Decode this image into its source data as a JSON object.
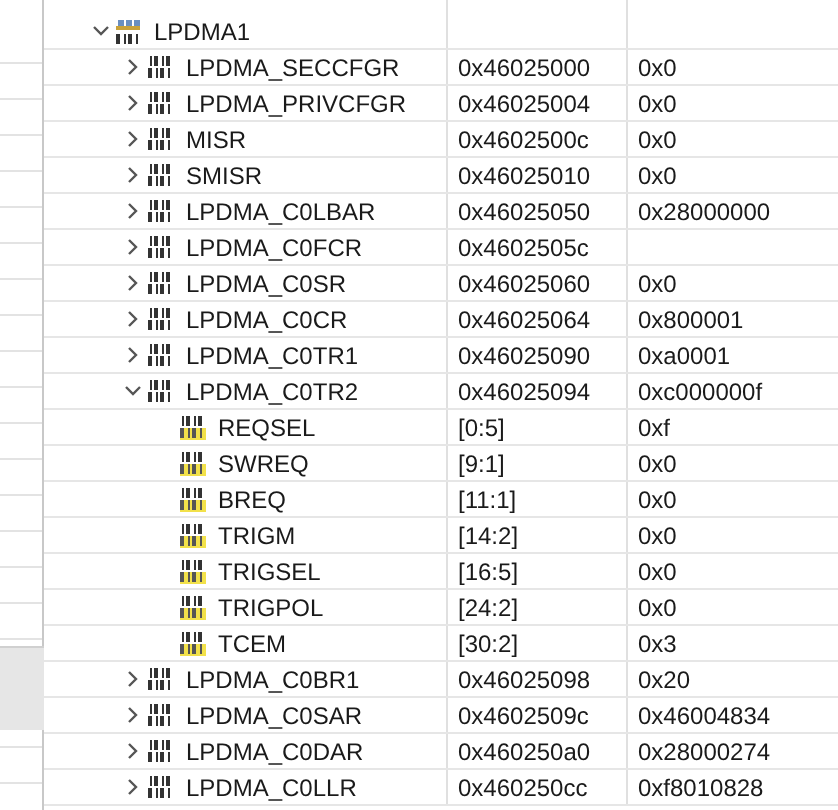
{
  "tree": {
    "kind": "peripheral",
    "name": "LPDMA1",
    "expanded": true,
    "children": [
      {
        "kind": "register",
        "name": "LPDMA_SECCFGR",
        "address": "0x46025000",
        "value": "0x0",
        "expanded": false
      },
      {
        "kind": "register",
        "name": "LPDMA_PRIVCFGR",
        "address": "0x46025004",
        "value": "0x0",
        "expanded": false
      },
      {
        "kind": "register",
        "name": "MISR",
        "address": "0x4602500c",
        "value": "0x0",
        "expanded": false
      },
      {
        "kind": "register",
        "name": "SMISR",
        "address": "0x46025010",
        "value": "0x0",
        "expanded": false
      },
      {
        "kind": "register",
        "name": "LPDMA_C0LBAR",
        "address": "0x46025050",
        "value": "0x28000000",
        "expanded": false
      },
      {
        "kind": "register",
        "name": "LPDMA_C0FCR",
        "address": "0x4602505c",
        "expanded": false
      },
      {
        "kind": "register",
        "name": "LPDMA_C0SR",
        "address": "0x46025060",
        "value": "0x0",
        "expanded": false
      },
      {
        "kind": "register",
        "name": "LPDMA_C0CR",
        "address": "0x46025064",
        "value": "0x800001",
        "expanded": false
      },
      {
        "kind": "register",
        "name": "LPDMA_C0TR1",
        "address": "0x46025090",
        "value": "0xa0001",
        "expanded": false
      },
      {
        "kind": "register",
        "name": "LPDMA_C0TR2",
        "address": "0x46025094",
        "value": "0xc000000f",
        "expanded": true,
        "children": [
          {
            "kind": "field",
            "name": "REQSEL",
            "address": "[0:5]",
            "value": "0xf"
          },
          {
            "kind": "field",
            "name": "SWREQ",
            "address": "[9:1]",
            "value": "0x0"
          },
          {
            "kind": "field",
            "name": "BREQ",
            "address": "[11:1]",
            "value": "0x0"
          },
          {
            "kind": "field",
            "name": "TRIGM",
            "address": "[14:2]",
            "value": "0x0"
          },
          {
            "kind": "field",
            "name": "TRIGSEL",
            "address": "[16:5]",
            "value": "0x0"
          },
          {
            "kind": "field",
            "name": "TRIGPOL",
            "address": "[24:2]",
            "value": "0x0"
          },
          {
            "kind": "field",
            "name": "TCEM",
            "address": "[30:2]",
            "value": "0x3"
          }
        ]
      },
      {
        "kind": "register",
        "name": "LPDMA_C0BR1",
        "address": "0x46025098",
        "value": "0x20",
        "expanded": false
      },
      {
        "kind": "register",
        "name": "LPDMA_C0SAR",
        "address": "0x4602509c",
        "value": "0x46004834",
        "expanded": false
      },
      {
        "kind": "register",
        "name": "LPDMA_C0DAR",
        "address": "0x460250a0",
        "value": "0x28000274",
        "expanded": false
      },
      {
        "kind": "register",
        "name": "LPDMA_C0LLR",
        "address": "0x460250cc",
        "value": "0xf8010828",
        "expanded": false
      }
    ]
  }
}
